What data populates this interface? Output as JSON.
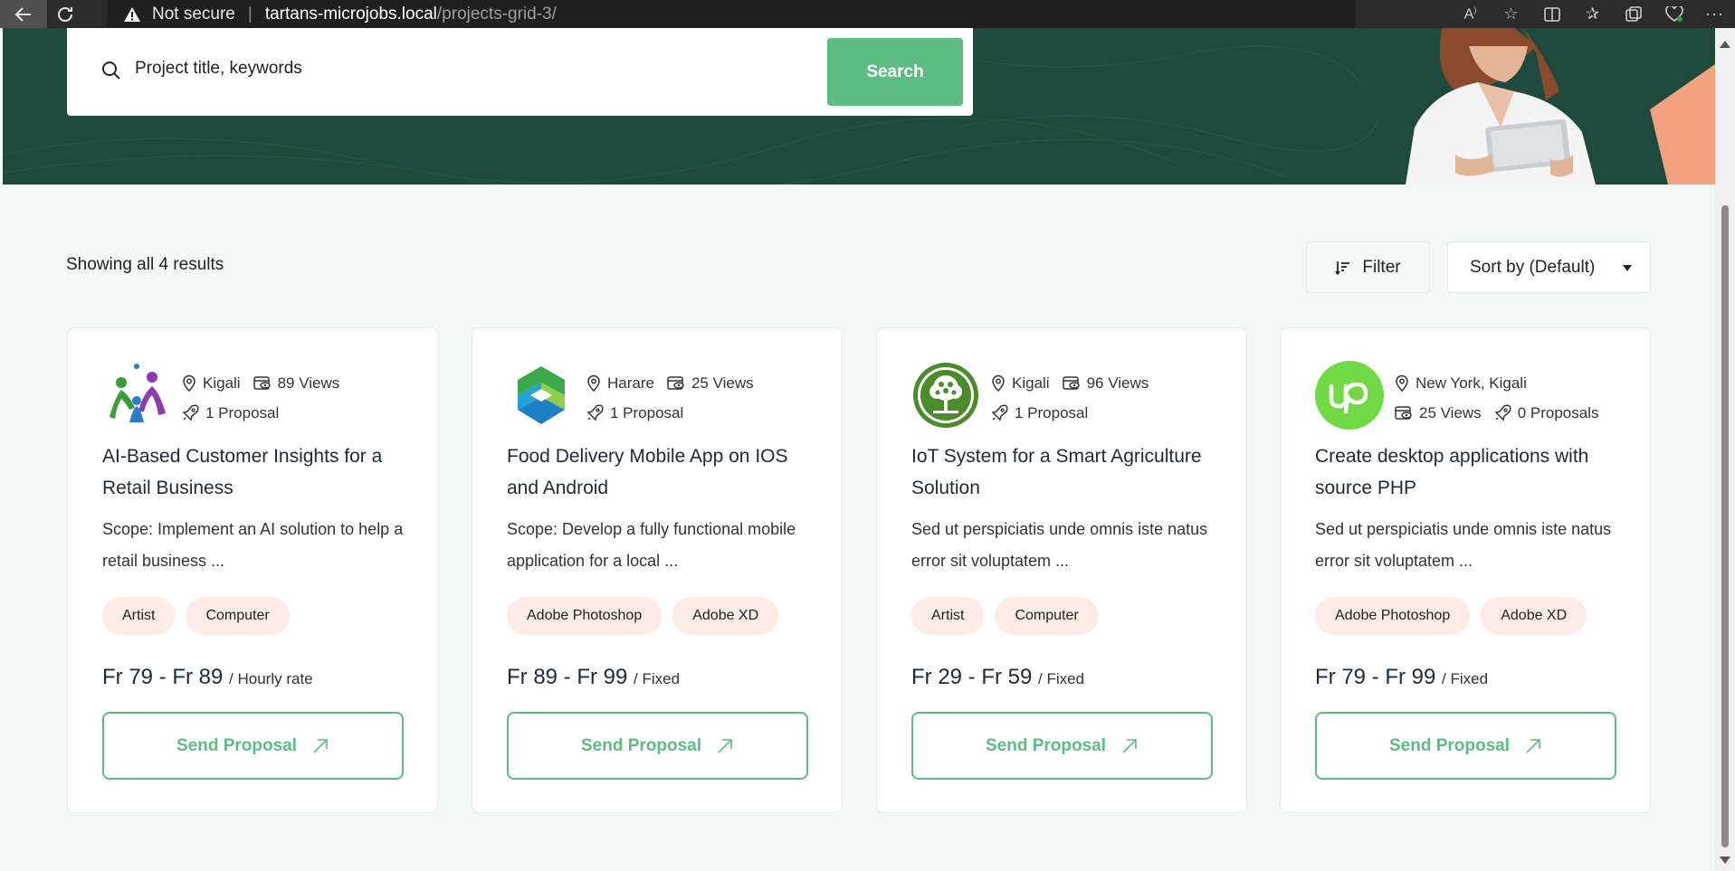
{
  "browser": {
    "security_label": "Not secure",
    "url_host": "tartans-microjobs.local",
    "url_path": "/projects-grid-3/"
  },
  "search": {
    "placeholder": "Project title, keywords",
    "button_label": "Search"
  },
  "results": {
    "count_text": "Showing all 4 results",
    "filter_label": "Filter",
    "sort_label": "Sort by (Default)"
  },
  "cards": [
    {
      "location": "Kigali",
      "views": "89 Views",
      "proposals": "1 Proposal",
      "title": "AI-Based Customer Insights for a Retail Business",
      "description": "Scope: Implement an AI solution to help a retail business ...",
      "tags": [
        "Artist",
        "Computer"
      ],
      "price": "Fr 79 - Fr 89",
      "price_unit": "/ Hourly rate",
      "button_label": "Send Proposal",
      "logo": "people-logo-icon"
    },
    {
      "location": "Harare",
      "views": "25 Views",
      "proposals": "1 Proposal",
      "title": "Food Delivery Mobile App on IOS and Android",
      "description": "Scope: Develop a fully functional mobile application for a local ...",
      "tags": [
        "Adobe Photoshop",
        "Adobe XD"
      ],
      "price": "Fr 89 - Fr 99",
      "price_unit": "/ Fixed",
      "button_label": "Send Proposal",
      "logo": "hexagon-logo-icon"
    },
    {
      "location": "Kigali",
      "views": "96 Views",
      "proposals": "1 Proposal",
      "title": "IoT System for a Smart Agriculture Solution",
      "description": "Sed ut perspiciatis unde omnis iste natus error sit voluptatem ...",
      "tags": [
        "Artist",
        "Computer"
      ],
      "price": "Fr 29 - Fr 59",
      "price_unit": "/ Fixed",
      "button_label": "Send Proposal",
      "logo": "tree-logo-icon"
    },
    {
      "location": "New York, Kigali",
      "views": "25 Views",
      "proposals": "0 Proposals",
      "title": "Create desktop applications with source PHP",
      "description": "Sed ut perspiciatis unde omnis iste natus error sit voluptatem ...",
      "tags": [
        "Adobe Photoshop",
        "Adobe XD"
      ],
      "price": "Fr 79 - Fr 99",
      "price_unit": "/ Fixed",
      "button_label": "Send Proposal",
      "logo": "upwork-logo-icon"
    }
  ],
  "colors": {
    "accent": "#5bbd82",
    "hero": "#1d4a3c",
    "page_bg": "#f0f9f6",
    "tag_bg": "#fdebe5"
  }
}
